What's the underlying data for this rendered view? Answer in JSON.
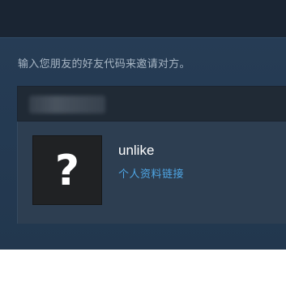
{
  "add_friend": {
    "instruction": "输入您朋友的好友代码来邀请对方。",
    "code_input": {
      "value": "",
      "placeholder": ""
    },
    "result": {
      "avatar_icon": "question-mark-icon",
      "avatar_glyph": "?",
      "username": "unlike",
      "profile_link_label": "个人资料链接"
    }
  },
  "colors": {
    "panel_bg": "#263c55",
    "input_bg": "#202a35",
    "card_bg": "#2d3e51",
    "link": "#4fa7e6",
    "instruction_text": "#a8b6c4"
  }
}
